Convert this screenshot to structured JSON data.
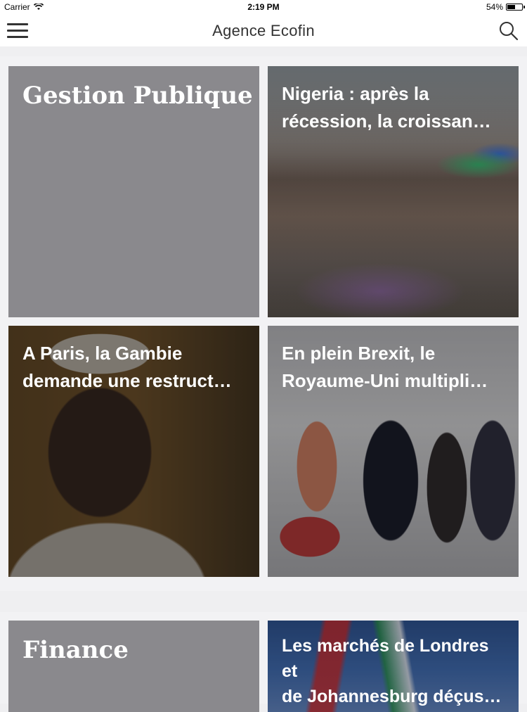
{
  "status_bar": {
    "carrier": "Carrier",
    "time": "2:19 PM",
    "battery": "54%",
    "battery_level": 0.54
  },
  "nav": {
    "title": "Agence Ecofin",
    "menu_icon": "hamburger-icon",
    "search_icon": "search-icon"
  },
  "sections": [
    {
      "category": "Gestion Publique",
      "articles": [
        {
          "headline": "Nigeria : après la\nrécession, la croissan…",
          "image": "market-photo"
        },
        {
          "headline": "A Paris, la Gambie\ndemande une restruct…",
          "image": "gambia-president-photo"
        },
        {
          "headline": "En plein Brexit, le\nRoyaume-Uni multipli…",
          "image": "brexit-reception-photo"
        }
      ]
    },
    {
      "category": "Finance",
      "articles": [
        {
          "headline": "Les marchés de Londres et\nde Johannesburg déçus…",
          "image": "flags-photo"
        }
      ]
    }
  ]
}
